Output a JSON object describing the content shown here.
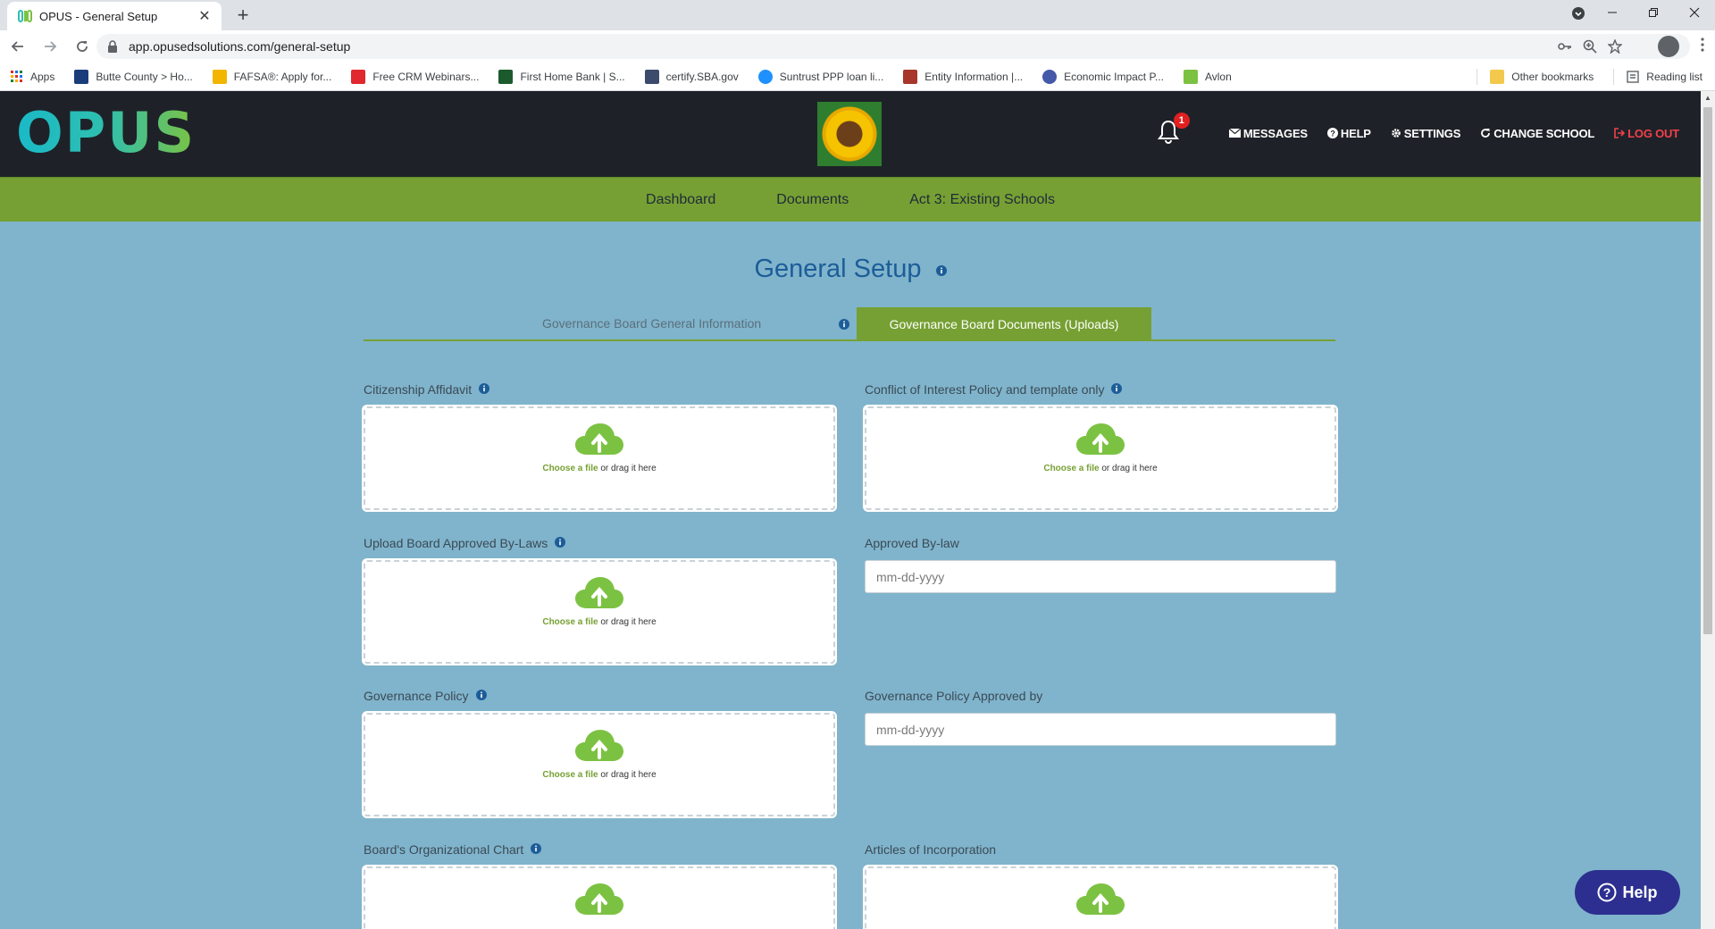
{
  "browser": {
    "tab_title": "OPUS - General Setup",
    "new_tab_glyph": "+",
    "close_tab_glyph": "✕",
    "url": "app.opusedsolutions.com/general-setup",
    "bookmarks": [
      {
        "label": "Apps",
        "color": "#d93025"
      },
      {
        "label": "Butte County > Ho...",
        "color": "#1a3d7a"
      },
      {
        "label": "FAFSA®: Apply for...",
        "color": "#f2b600"
      },
      {
        "label": "Free CRM Webinars...",
        "color": "#e0282e"
      },
      {
        "label": "First Home Bank | S...",
        "color": "#1c5a2e"
      },
      {
        "label": "certify.SBA.gov",
        "color": "#3c4a6b"
      },
      {
        "label": "Suntrust PPP loan li...",
        "color": "#1e90ff"
      },
      {
        "label": "Entity Information |...",
        "color": "#a8362a"
      },
      {
        "label": "Economic Impact P...",
        "color": "#4459a8"
      },
      {
        "label": "Avlon",
        "color": "#7cc242"
      }
    ],
    "other_bookmarks": "Other bookmarks",
    "reading_list": "Reading list"
  },
  "header": {
    "logo_text": "OPUS",
    "notification_count": "1",
    "nav": {
      "messages": "MESSAGES",
      "help": "HELP",
      "settings": "SETTINGS",
      "change_school": "CHANGE SCHOOL",
      "logout": "LOG OUT"
    }
  },
  "main_nav": {
    "dashboard": "Dashboard",
    "documents": "Documents",
    "act3": "Act 3: Existing Schools"
  },
  "page": {
    "title": "General Setup",
    "tabs": {
      "general_info": "Governance Board General Information",
      "documents": "Governance Board Documents (Uploads)"
    },
    "upload_choose": "Choose a file",
    "upload_rest": " or drag it here",
    "fields": {
      "citizenship": "Citizenship Affidavit",
      "conflict": "Conflict of Interest Policy and template only",
      "bylaws": "Upload Board Approved By-Laws",
      "approved_bylaw": "Approved By-law",
      "approved_bylaw_placeholder": "mm-dd-yyyy",
      "governance_policy": "Governance Policy",
      "governance_policy_approved": "Governance Policy Approved by",
      "governance_policy_approved_placeholder": "mm-dd-yyyy",
      "org_chart": "Board's Organizational Chart",
      "articles": "Articles of Incorporation"
    }
  },
  "help_button": "Help",
  "colors": {
    "page_bg": "#80b4cc",
    "header_bg": "#1e2228",
    "brand_green": "#76a033",
    "title_blue": "#1c5d99",
    "logout_red": "#f2404a",
    "help_bg": "#2c2f8f"
  }
}
